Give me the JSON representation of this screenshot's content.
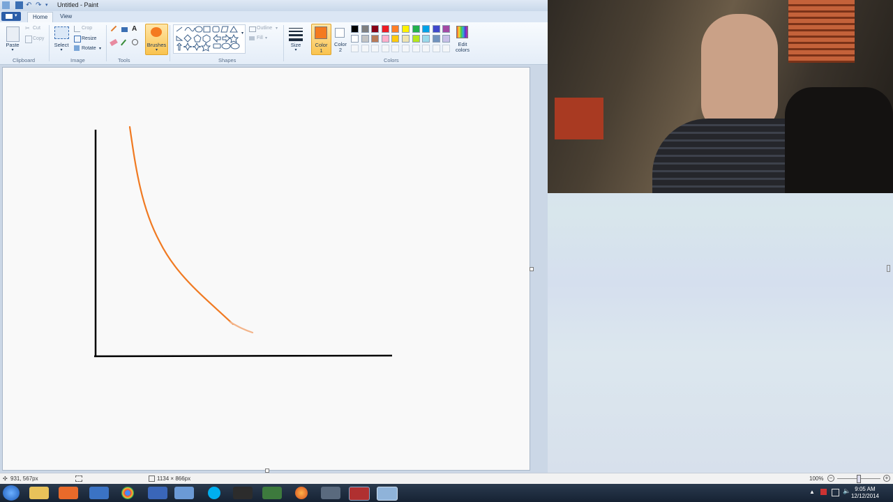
{
  "window": {
    "title": "Untitled - Paint",
    "quick_access_icons": [
      "save-icon",
      "undo-icon",
      "redo-icon",
      "customize-dropdown-icon"
    ]
  },
  "tabs": [
    {
      "label": "Home",
      "active": true
    },
    {
      "label": "View",
      "active": false
    }
  ],
  "ribbon": {
    "clipboard": {
      "label": "Clipboard",
      "paste": "Paste",
      "cut": "Cut",
      "copy": "Copy"
    },
    "image": {
      "label": "Image",
      "select": "Select",
      "crop": "Crop",
      "resize": "Resize",
      "rotate": "Rotate"
    },
    "tools": {
      "label": "Tools"
    },
    "brushes": {
      "label": "Brushes"
    },
    "shapes": {
      "label": "Shapes",
      "outline": "Outline",
      "fill": "Fill"
    },
    "size": {
      "label": "Size"
    },
    "color1": {
      "label_line1": "Color",
      "label_line2": "1",
      "color": "#f47a20"
    },
    "color2": {
      "label_line1": "Color",
      "label_line2": "2",
      "color": "#ffffff"
    },
    "colors": {
      "label": "Colors"
    },
    "edit_colors": {
      "line1": "Edit",
      "line2": "colors"
    },
    "palette_row1": [
      "#000000",
      "#7f7f7f",
      "#880015",
      "#ed1c24",
      "#ff7f27",
      "#fff200",
      "#22b14c",
      "#00a2e8",
      "#3f48cc",
      "#a349a4"
    ],
    "palette_row2": [
      "#ffffff",
      "#c3c3c3",
      "#b97a57",
      "#ffaec9",
      "#ffc90e",
      "#efe4b0",
      "#b5e61d",
      "#99d9ea",
      "#7092be",
      "#c8bfe7"
    ]
  },
  "drawing": {
    "axis_color": "#000000",
    "curve_color": "#f07a22"
  },
  "status": {
    "cursor_pos": "931, 567px",
    "canvas_size": "1134 × 866px",
    "zoom": "100%"
  },
  "taskbar": {
    "clock_time": "9:05 AM",
    "clock_date": "12/12/2014"
  }
}
